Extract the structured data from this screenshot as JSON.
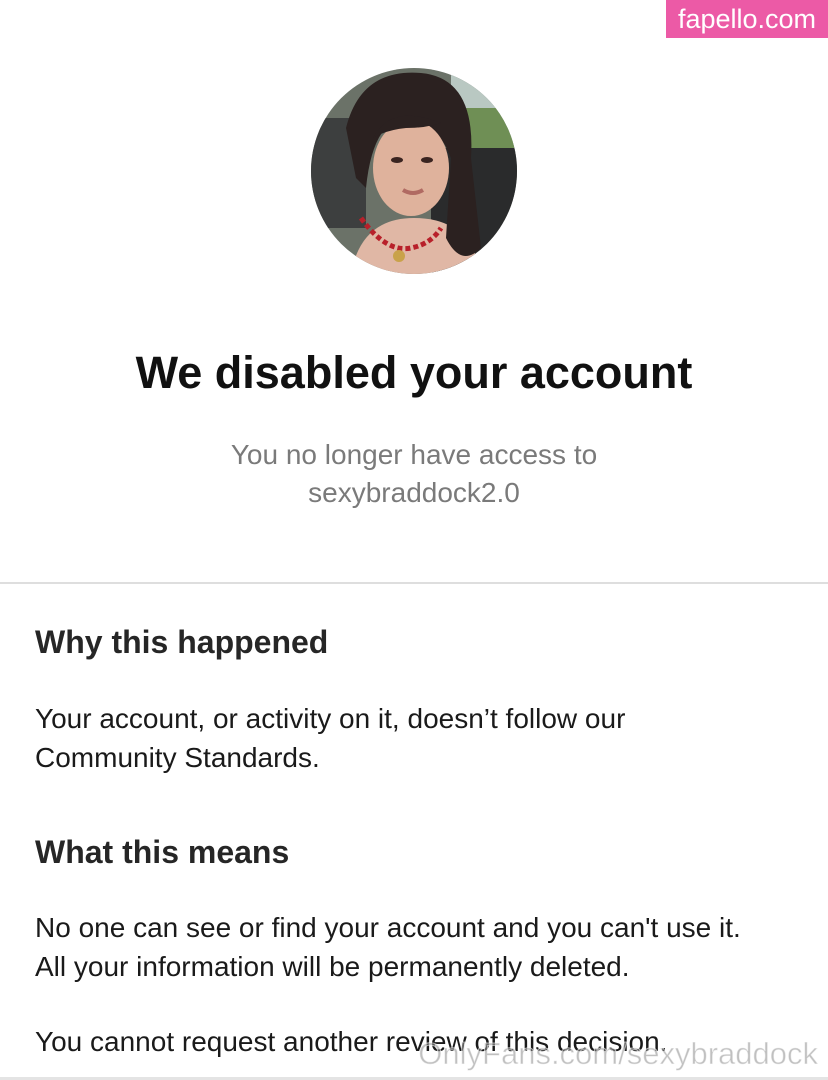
{
  "watermark": {
    "top": "fapello.com",
    "bottom": "OnlyFans.com/sexybraddock"
  },
  "header": {
    "title": "We disabled your account",
    "subtitle_line1": "You no longer have access to",
    "subtitle_line2": "sexybraddock2.0"
  },
  "sections": [
    {
      "heading": "Why this happened",
      "lines": [
        "Your account, or activity on it, doesn’t follow our",
        "Community Standards."
      ]
    },
    {
      "heading": "What this means",
      "lines": [
        "No one can see or find your account and you can't use it.",
        "All your information will be permanently deleted."
      ]
    }
  ],
  "footer_note": "You cannot request another review of this decision.",
  "colors": {
    "watermark_bg": "#ec5aa6",
    "title": "#111111",
    "subtitle": "#7a7a7a"
  }
}
